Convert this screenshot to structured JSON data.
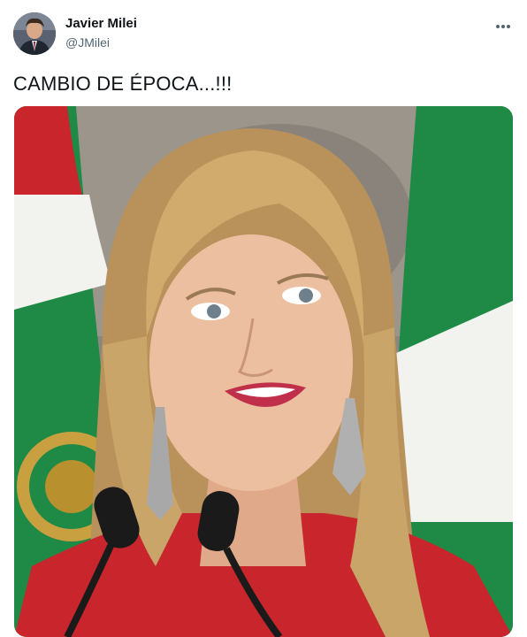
{
  "tweet": {
    "author_name": "Javier Milei",
    "author_handle": "@JMilei",
    "text": "CAMBIO DE ÉPOCA...!!!",
    "more_icon": "more-horizontal-icon"
  },
  "media": {
    "description_tag": "photo",
    "colors": {
      "flag_green": "#1f8a45",
      "flag_red": "#c8262c",
      "flag_white": "#f2f2ee",
      "jacket_red": "#c8262c",
      "hair_blond": "#c9a56a",
      "skin": "#e8b99a"
    }
  }
}
